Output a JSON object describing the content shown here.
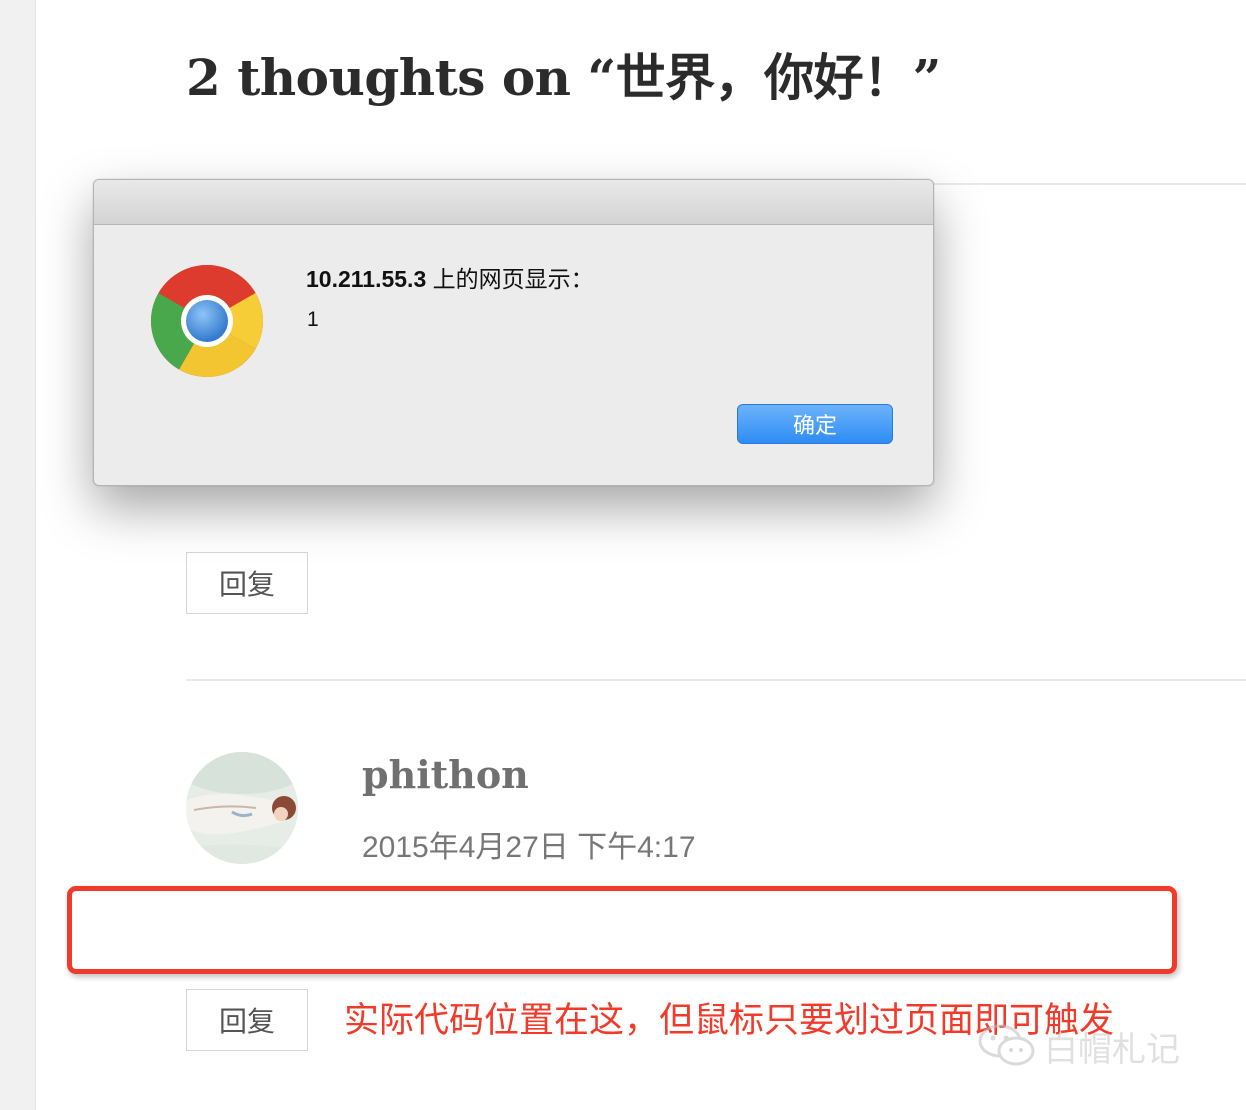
{
  "page": {
    "title": "2 thoughts on “世界，你好！”"
  },
  "alert": {
    "host": "10.211.55.3",
    "heading_suffix": " 上的网页显示：",
    "message": "1",
    "ok_label": "确定",
    "icon": "chrome-icon"
  },
  "comments": [
    {
      "reply_label": "回复"
    },
    {
      "author": "phithon",
      "date": "2015年4月27日 下午4:17",
      "reply_label": "回复"
    }
  ],
  "annotation": {
    "text": "实际代码位置在这，但鼠标只要划过页面即可触发",
    "color": "#f23a2b"
  },
  "watermark": {
    "text": "白帽札记",
    "icon": "wechat-icon"
  }
}
